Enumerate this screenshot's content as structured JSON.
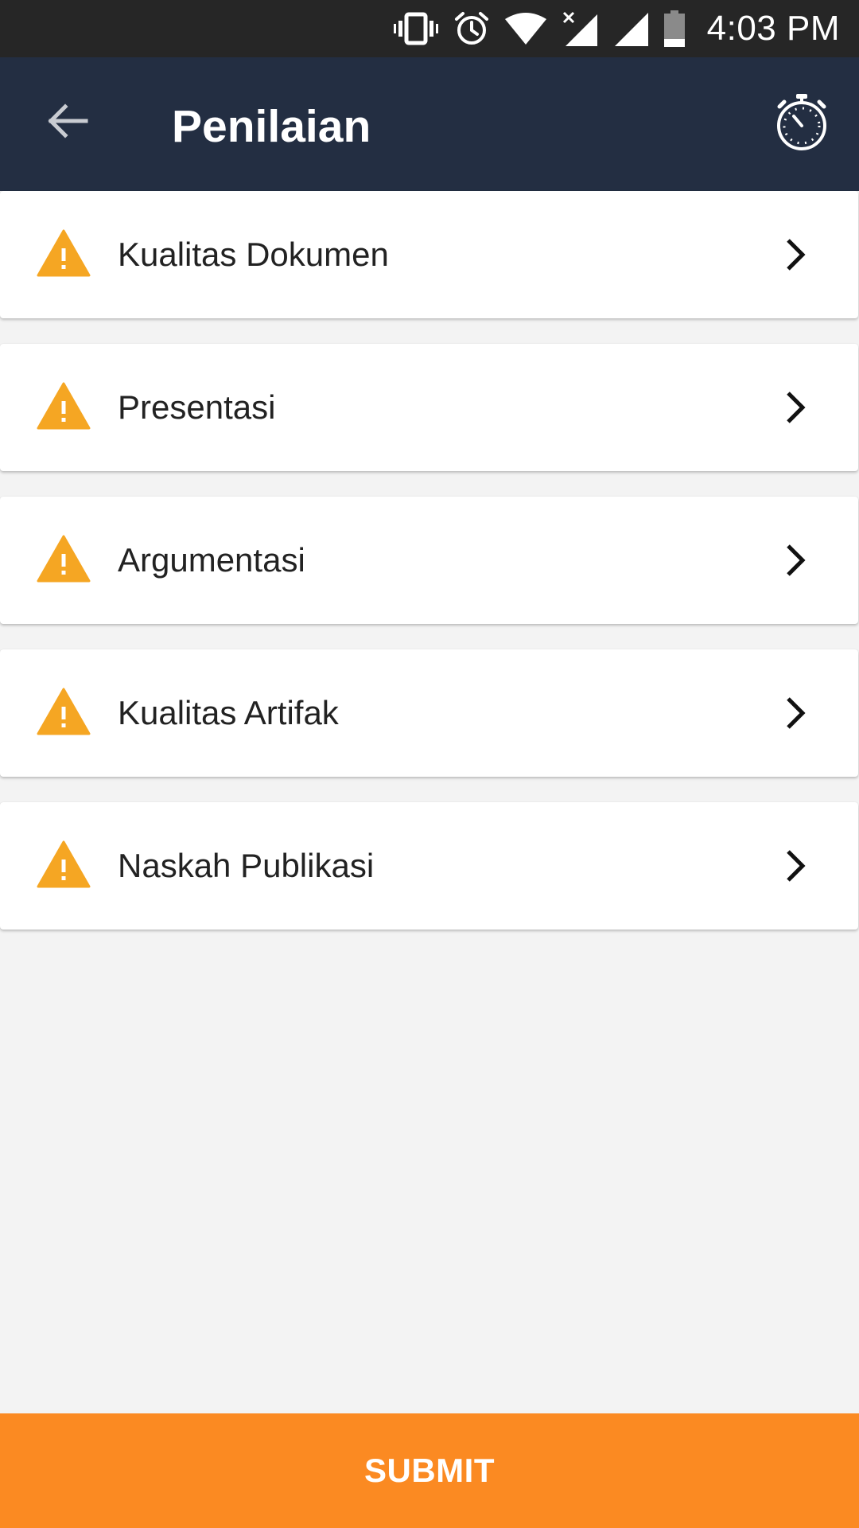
{
  "status_bar": {
    "time": "4:03 PM",
    "icons": [
      "vibrate-icon",
      "alarm-icon",
      "wifi-icon",
      "signal-no-data-icon",
      "signal-icon",
      "battery-icon"
    ]
  },
  "app_bar": {
    "title": "Penilaian",
    "back_icon": "arrow-back-icon",
    "timer_icon": "stopwatch-icon",
    "background": "#232e42"
  },
  "items": [
    {
      "label": "Kualitas Dokumen",
      "icon": "warning-icon"
    },
    {
      "label": "Presentasi",
      "icon": "warning-icon"
    },
    {
      "label": "Argumentasi",
      "icon": "warning-icon"
    },
    {
      "label": "Kualitas Artifak",
      "icon": "warning-icon"
    },
    {
      "label": "Naskah Publikasi",
      "icon": "warning-icon"
    }
  ],
  "submit_label": "SUBMIT",
  "colors": {
    "warning": "#f5a623",
    "submit": "#fb8a22",
    "background": "#f3f3f3"
  }
}
